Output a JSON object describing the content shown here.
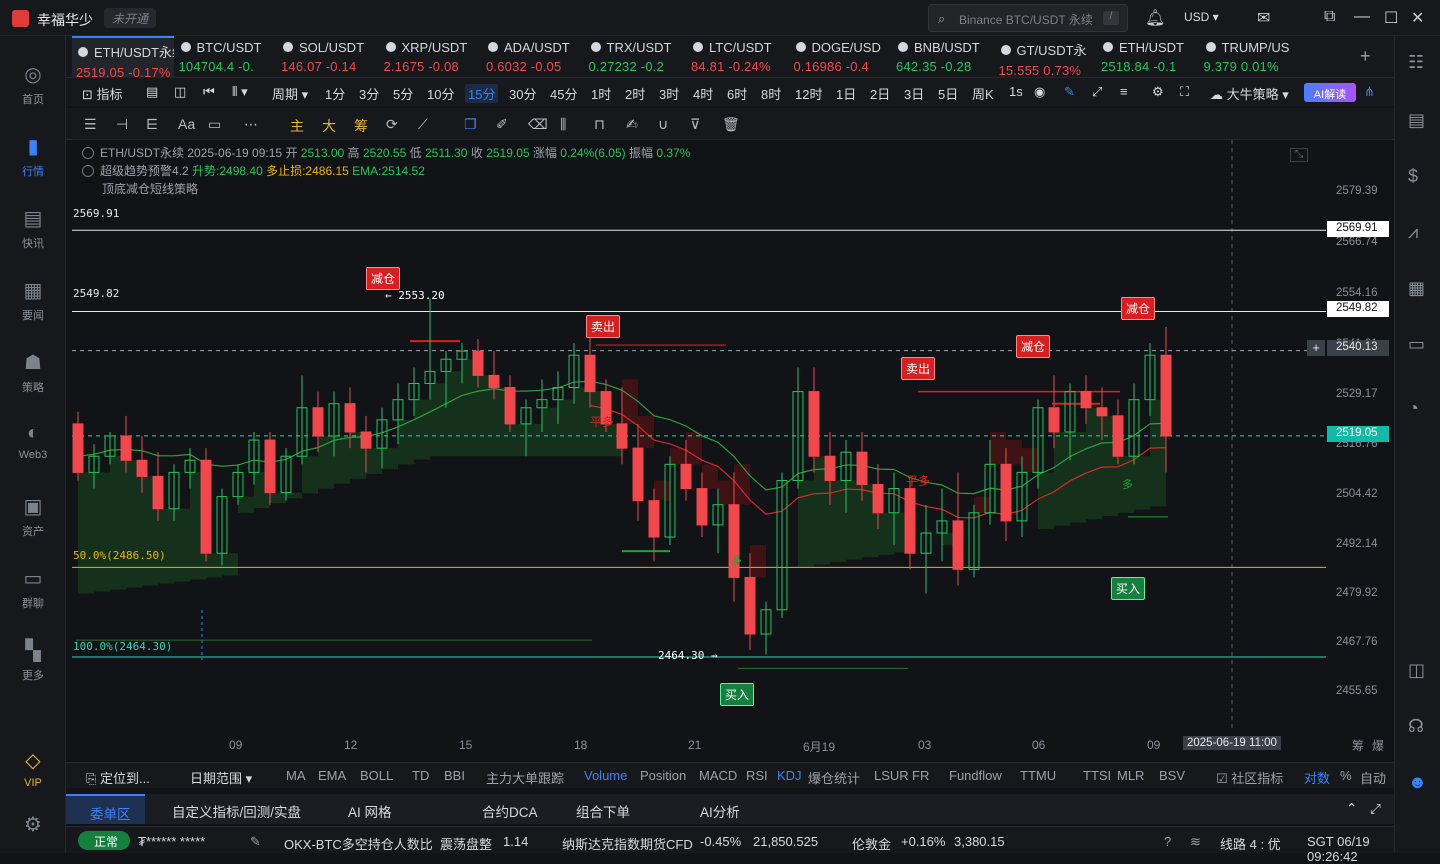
{
  "app": {
    "name": "幸福华少",
    "account_status": "未开通",
    "search_placeholder": "Binance BTC/USDT 永续",
    "search_shortcut": "/",
    "currency": "USD"
  },
  "left_nav": [
    {
      "label": "首页",
      "icon": "home-icon"
    },
    {
      "label": "行情",
      "icon": "market-chart-icon"
    },
    {
      "label": "快讯",
      "icon": "flash-news-icon"
    },
    {
      "label": "要闻",
      "icon": "news-icon"
    },
    {
      "label": "策略",
      "icon": "robot-icon"
    },
    {
      "label": "Web3",
      "icon": "web3-icon"
    },
    {
      "label": "资产",
      "icon": "wallet-icon"
    },
    {
      "label": "群聊",
      "icon": "chat-icon"
    },
    {
      "label": "更多",
      "icon": "grid-icon"
    },
    {
      "label": "VIP",
      "icon": "vip-diamond-icon"
    }
  ],
  "tabs": [
    {
      "name": "ETH/USDT永续",
      "price": "2519.05",
      "change": "-0.17%",
      "dir": "dn"
    },
    {
      "name": "BTC/USDT",
      "price": "104704.4",
      "change": "-0.",
      "dir": "up"
    },
    {
      "name": "SOL/USDT",
      "price": "146.07",
      "change": "-0.14",
      "dir": "dn"
    },
    {
      "name": "XRP/USDT",
      "price": "2.1675",
      "change": "-0.08",
      "dir": "dn"
    },
    {
      "name": "ADA/USDT",
      "price": "0.6032",
      "change": "-0.05",
      "dir": "dn"
    },
    {
      "name": "TRX/USDT",
      "price": "0.27232",
      "change": "-0.2",
      "dir": "up"
    },
    {
      "name": "LTC/USDT",
      "price": "84.81",
      "change": "-0.24%",
      "dir": "dn"
    },
    {
      "name": "DOGE/USD",
      "price": "0.16986",
      "change": "-0.4",
      "dir": "dn"
    },
    {
      "name": "BNB/USDT",
      "price": "642.35",
      "change": "-0.28",
      "dir": "up"
    },
    {
      "name": "GT/USDT永",
      "price": "15.555",
      "change": "0.73%",
      "dir": "dn"
    },
    {
      "name": "ETH/USDT",
      "price": "2518.84",
      "change": "-0.1",
      "dir": "up"
    },
    {
      "name": "TRUMP/US",
      "price": "9.379",
      "change": "0.01%",
      "dir": "up"
    }
  ],
  "toolbar": {
    "indicator_label": "指标",
    "period_label": "周期",
    "timeframes": [
      "1分",
      "3分",
      "5分",
      "10分",
      "15分",
      "30分",
      "45分",
      "1时",
      "2时",
      "3时",
      "4时",
      "6时",
      "8时",
      "12时",
      "1日",
      "2日",
      "3日",
      "5日",
      "周K"
    ],
    "selected_timeframe": "15分",
    "seconds_label": "1s",
    "strategy_label": "大牛策略",
    "ai_label": "AI解读"
  },
  "drawing_tools": {
    "zhu": "主",
    "da": "大",
    "chou": "筹",
    "font": "Aa"
  },
  "legend": {
    "symbol_time": "ETH/USDT永续 2025-06-19 09:15",
    "open_label": "开",
    "open": "2513.00",
    "high_label": "高",
    "high": "2520.55",
    "low_label": "低",
    "low": "2511.30",
    "close_label": "收",
    "close": "2519.05",
    "change_label": "涨幅",
    "change": "0.24%(6.05)",
    "amp_label": "振幅",
    "amp": "0.37%",
    "indicator_name": "超级趋势预警4.2",
    "trend_label": "升势:2498.40",
    "stop_label": "多止损:2486.15",
    "ema_label": "EMA:2514.52",
    "strategy_name": "顶底减仓短线策略"
  },
  "levels": {
    "top_left": "2569.91",
    "second_left": "2549.82",
    "fib50": "50.0%(2486.50)",
    "fib100": "100.0%(2464.30)",
    "high_marker": "← 2553.20",
    "low_marker": "2464.30 →"
  },
  "price_tags": {
    "t1": "2569.91",
    "t2": "2549.82",
    "t3": "2540.13",
    "current": "2519.05"
  },
  "y_axis": [
    "2579.39",
    "2566.74",
    "2554.16",
    "2541.61",
    "2529.17",
    "2516.76",
    "2504.42",
    "2492.14",
    "2479.92",
    "2467.76",
    "2455.65"
  ],
  "x_axis": [
    "09",
    "12",
    "15",
    "18",
    "21",
    "6月19",
    "03",
    "06",
    "09"
  ],
  "crosshair_time": "2025-06-19 11:00",
  "signals": {
    "reduce": "减仓",
    "sell": "卖出",
    "buy": "买入",
    "pingduo": "平多",
    "duo": "多"
  },
  "bottom_corner": {
    "a": "筹",
    "b": "爆"
  },
  "indicator_bar": {
    "locate": "定位到...",
    "range": "日期范围",
    "items": [
      "MA",
      "EMA",
      "BOLL",
      "TD",
      "BBI",
      "主力大单跟踪"
    ],
    "subs": [
      "Volume",
      "Position",
      "MACD",
      "RSI",
      "KDJ",
      "爆仓统计",
      "LSUR",
      "FR",
      "Fundflow",
      "TTMU",
      "TTSI",
      "MLR",
      "BSV"
    ],
    "selected_sub": "Volume",
    "community": "社区指标",
    "log": "对数",
    "pct": "%",
    "auto": "自动"
  },
  "pane_tabs": [
    "委单区",
    "自定义指标/回测/实盘",
    "AI 网格",
    "合约DCA",
    "组合下单",
    "AI分析"
  ],
  "status": {
    "ok": "正常",
    "account_mask": "₮****** *****",
    "ticker1_name": "OKX-BTC多空持仓人数比",
    "ticker1_state": "震荡盘整",
    "ticker1_val": "1.14",
    "ticker2_name": "纳斯达克指数期货CFD",
    "ticker2_change": "-0.45%",
    "ticker2_val": "21,850.525",
    "ticker3_name": "伦敦金",
    "ticker3_change": "+0.16%",
    "ticker3_val": "3,380.15",
    "line": "线路 4 : 优",
    "clock": "SGT 06/19 09:26:42"
  },
  "chart_data": {
    "type": "candlestick",
    "symbol": "ETH/USDT永续",
    "interval": "15分",
    "ylim": [
      2450,
      2585
    ],
    "candles_ohlc": [
      [
        2522,
        2525,
        2508,
        2510
      ],
      [
        2510,
        2517,
        2506,
        2514
      ],
      [
        2514,
        2520,
        2512,
        2519
      ],
      [
        2519,
        2524,
        2510,
        2513
      ],
      [
        2513,
        2519,
        2505,
        2509
      ],
      [
        2509,
        2515,
        2498,
        2501
      ],
      [
        2501,
        2512,
        2498,
        2510
      ],
      [
        2510,
        2516,
        2506,
        2513
      ],
      [
        2513,
        2516,
        2488,
        2490
      ],
      [
        2490,
        2506,
        2487,
        2504
      ],
      [
        2504,
        2512,
        2502,
        2510
      ],
      [
        2510,
        2520,
        2507,
        2518
      ],
      [
        2518,
        2520,
        2502,
        2505
      ],
      [
        2505,
        2516,
        2503,
        2514
      ],
      [
        2514,
        2534,
        2512,
        2526
      ],
      [
        2526,
        2530,
        2515,
        2519
      ],
      [
        2519,
        2530,
        2514,
        2527
      ],
      [
        2527,
        2531,
        2516,
        2520
      ],
      [
        2520,
        2524,
        2510,
        2516
      ],
      [
        2516,
        2526,
        2511,
        2523
      ],
      [
        2523,
        2532,
        2517,
        2528
      ],
      [
        2528,
        2536,
        2524,
        2532
      ],
      [
        2532,
        2553,
        2528,
        2535
      ],
      [
        2535,
        2540,
        2526,
        2538
      ],
      [
        2538,
        2542,
        2532,
        2540
      ],
      [
        2540,
        2543,
        2531,
        2534
      ],
      [
        2534,
        2540,
        2528,
        2531
      ],
      [
        2531,
        2534,
        2520,
        2522
      ],
      [
        2522,
        2528,
        2514,
        2526
      ],
      [
        2526,
        2533,
        2520,
        2528
      ],
      [
        2528,
        2535,
        2522,
        2531
      ],
      [
        2531,
        2542,
        2527,
        2539
      ],
      [
        2539,
        2544,
        2526,
        2530
      ],
      [
        2530,
        2533,
        2520,
        2522
      ],
      [
        2522,
        2531,
        2512,
        2516
      ],
      [
        2516,
        2522,
        2498,
        2503
      ],
      [
        2503,
        2506,
        2488,
        2494
      ],
      [
        2494,
        2514,
        2492,
        2512
      ],
      [
        2512,
        2518,
        2503,
        2506
      ],
      [
        2506,
        2510,
        2494,
        2497
      ],
      [
        2497,
        2506,
        2490,
        2502
      ],
      [
        2502,
        2510,
        2478,
        2484
      ],
      [
        2484,
        2490,
        2466,
        2470
      ],
      [
        2470,
        2478,
        2465,
        2476
      ],
      [
        2476,
        2510,
        2474,
        2508
      ],
      [
        2508,
        2536,
        2506,
        2530
      ],
      [
        2530,
        2536,
        2510,
        2514
      ],
      [
        2514,
        2520,
        2502,
        2508
      ],
      [
        2508,
        2518,
        2500,
        2515
      ],
      [
        2515,
        2520,
        2503,
        2507
      ],
      [
        2507,
        2512,
        2496,
        2500
      ],
      [
        2500,
        2510,
        2492,
        2506
      ],
      [
        2506,
        2508,
        2486,
        2490
      ],
      [
        2490,
        2502,
        2480,
        2495
      ],
      [
        2495,
        2506,
        2488,
        2498
      ],
      [
        2498,
        2510,
        2482,
        2486
      ],
      [
        2486,
        2502,
        2484,
        2500
      ],
      [
        2500,
        2518,
        2497,
        2512
      ],
      [
        2512,
        2516,
        2493,
        2498
      ],
      [
        2498,
        2514,
        2494,
        2510
      ],
      [
        2510,
        2528,
        2506,
        2526
      ],
      [
        2526,
        2534,
        2516,
        2520
      ],
      [
        2520,
        2532,
        2513,
        2530
      ],
      [
        2530,
        2534,
        2522,
        2526
      ],
      [
        2526,
        2531,
        2518,
        2524
      ],
      [
        2524,
        2528,
        2512,
        2514
      ],
      [
        2514,
        2532,
        2512,
        2528
      ],
      [
        2528,
        2542,
        2524,
        2539
      ],
      [
        2539,
        2546,
        2510,
        2519
      ]
    ],
    "overlays": {
      "supertrend_up": 2498.4,
      "long_stop": 2486.15,
      "ema": 2514.52,
      "fib_50": 2486.5,
      "fib_100": 2464.3,
      "horizontal_lines": [
        2569.91,
        2549.82
      ]
    },
    "x_ticks": [
      "09",
      "12",
      "15",
      "18",
      "21",
      "6月19",
      "03",
      "06",
      "09"
    ],
    "y_ticks": [
      2579.39,
      2566.74,
      2554.16,
      2541.61,
      2529.17,
      2516.76,
      2504.42,
      2492.14,
      2479.92,
      2467.76,
      2455.65
    ],
    "last_price": 2519.05
  }
}
